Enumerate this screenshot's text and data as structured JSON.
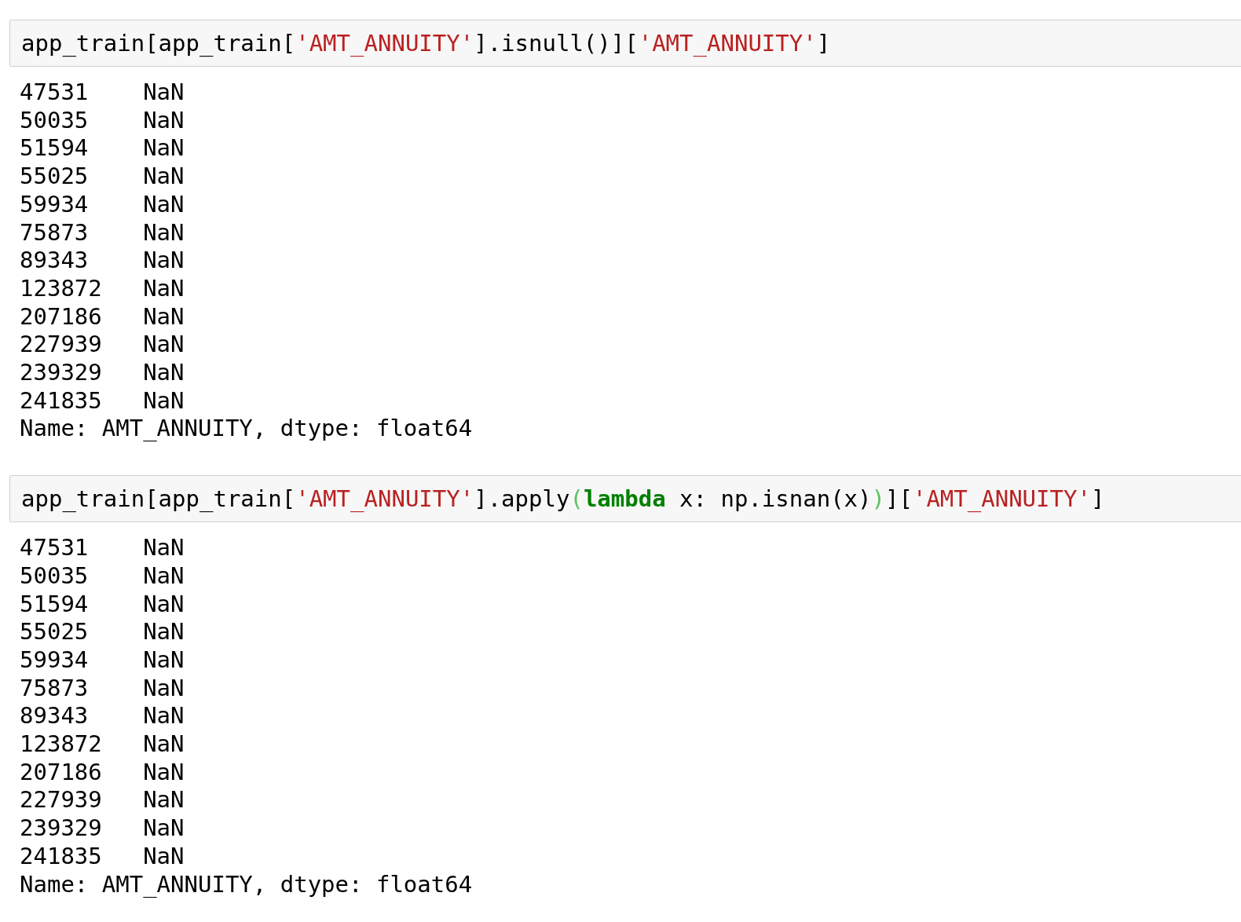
{
  "cells": [
    {
      "input": [
        {
          "kind": "plain",
          "text": "app_train[app_train["
        },
        {
          "kind": "string",
          "text": "'AMT_ANNUITY'"
        },
        {
          "kind": "plain",
          "text": "].isnull()]["
        },
        {
          "kind": "string",
          "text": "'AMT_ANNUITY'"
        },
        {
          "kind": "plain",
          "text": "]"
        }
      ],
      "output": {
        "rows": [
          {
            "index": "47531",
            "value": "NaN"
          },
          {
            "index": "50035",
            "value": "NaN"
          },
          {
            "index": "51594",
            "value": "NaN"
          },
          {
            "index": "55025",
            "value": "NaN"
          },
          {
            "index": "59934",
            "value": "NaN"
          },
          {
            "index": "75873",
            "value": "NaN"
          },
          {
            "index": "89343",
            "value": "NaN"
          },
          {
            "index": "123872",
            "value": "NaN"
          },
          {
            "index": "207186",
            "value": "NaN"
          },
          {
            "index": "227939",
            "value": "NaN"
          },
          {
            "index": "239329",
            "value": "NaN"
          },
          {
            "index": "241835",
            "value": "NaN"
          }
        ],
        "footer": "Name: AMT_ANNUITY, dtype: float64"
      }
    },
    {
      "input": [
        {
          "kind": "plain",
          "text": "app_train[app_train["
        },
        {
          "kind": "string",
          "text": "'AMT_ANNUITY'"
        },
        {
          "kind": "plain",
          "text": "].apply"
        },
        {
          "kind": "bracket",
          "text": "("
        },
        {
          "kind": "keyword",
          "text": "lambda"
        },
        {
          "kind": "plain",
          "text": " x: np.isnan(x)"
        },
        {
          "kind": "bracket",
          "text": ")"
        },
        {
          "kind": "plain",
          "text": "]["
        },
        {
          "kind": "string",
          "text": "'AMT_ANNUITY'"
        },
        {
          "kind": "plain",
          "text": "]"
        }
      ],
      "output": {
        "rows": [
          {
            "index": "47531",
            "value": "NaN"
          },
          {
            "index": "50035",
            "value": "NaN"
          },
          {
            "index": "51594",
            "value": "NaN"
          },
          {
            "index": "55025",
            "value": "NaN"
          },
          {
            "index": "59934",
            "value": "NaN"
          },
          {
            "index": "75873",
            "value": "NaN"
          },
          {
            "index": "89343",
            "value": "NaN"
          },
          {
            "index": "123872",
            "value": "NaN"
          },
          {
            "index": "207186",
            "value": "NaN"
          },
          {
            "index": "227939",
            "value": "NaN"
          },
          {
            "index": "239329",
            "value": "NaN"
          },
          {
            "index": "241835",
            "value": "NaN"
          }
        ],
        "footer": "Name: AMT_ANNUITY, dtype: float64"
      }
    }
  ]
}
